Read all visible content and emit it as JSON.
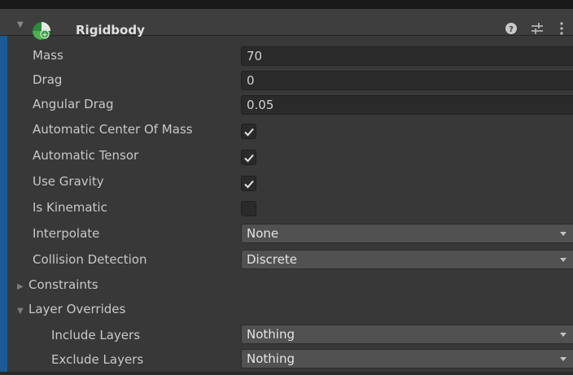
{
  "component": {
    "title": "Rigidbody",
    "icon": "rigidbody-component-icon",
    "header_icons": [
      "help-icon",
      "presets-icon",
      "kebab-menu-icon"
    ]
  },
  "properties": [
    {
      "label": "Mass",
      "type": "float",
      "value": "70"
    },
    {
      "label": "Drag",
      "type": "float",
      "value": "0"
    },
    {
      "label": "Angular Drag",
      "type": "float",
      "value": "0.05"
    },
    {
      "label": "Automatic Center Of Mass",
      "type": "checkbox",
      "checked": true
    },
    {
      "label": "Automatic Tensor",
      "type": "checkbox",
      "checked": true
    },
    {
      "label": "Use Gravity",
      "type": "checkbox",
      "checked": true
    },
    {
      "label": "Is Kinematic",
      "type": "checkbox",
      "checked": false
    },
    {
      "label": "Interpolate",
      "type": "dropdown",
      "value": "None"
    },
    {
      "label": "Collision Detection",
      "type": "dropdown",
      "value": "Discrete"
    }
  ],
  "foldouts": [
    {
      "label": "Constraints",
      "expanded": false
    },
    {
      "label": "Layer Overrides",
      "expanded": true,
      "children": [
        {
          "label": "Include Layers",
          "type": "dropdown",
          "value": "Nothing"
        },
        {
          "label": "Exclude Layers",
          "type": "dropdown",
          "value": "Nothing"
        }
      ]
    }
  ],
  "colors": {
    "accent": "#1b5a94",
    "panel": "#383838",
    "field": "#2a2a2a",
    "dropdown": "#515151"
  }
}
